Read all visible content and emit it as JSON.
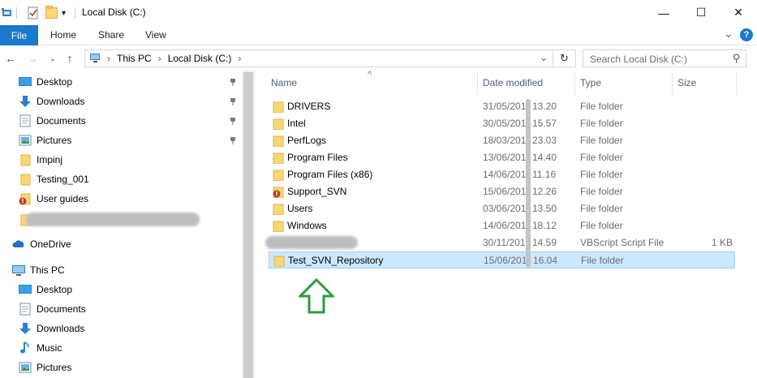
{
  "window": {
    "title": "Local Disk (C:)",
    "minimize_glyph": "—",
    "maximize_glyph": "☐",
    "close_glyph": "✕"
  },
  "ribbon": {
    "tabs": [
      "File",
      "Home",
      "Share",
      "View"
    ],
    "expand_glyph": "⌄",
    "help_glyph": "?"
  },
  "nav": {
    "back_glyph": "←",
    "forward_glyph": "→",
    "recent_glyph": "⌄",
    "up_glyph": "↑",
    "address_segments": [
      "This PC",
      "Local Disk (C:)"
    ],
    "separator": "›",
    "dropdown_glyph": "⌄",
    "refresh_glyph": "↻",
    "search_placeholder": "Search Local Disk (C:)",
    "search_glyph": "⚲"
  },
  "sidebar": {
    "quick_access": [
      {
        "label": "Desktop",
        "icon": "desktop-icon",
        "pinned": true
      },
      {
        "label": "Downloads",
        "icon": "downloads-icon",
        "pinned": true
      },
      {
        "label": "Documents",
        "icon": "documents-icon",
        "pinned": true
      },
      {
        "label": "Pictures",
        "icon": "pictures-icon",
        "pinned": true
      },
      {
        "label": "Impinj",
        "icon": "folder-icon",
        "pinned": false
      },
      {
        "label": "Testing_001",
        "icon": "folder-icon",
        "pinned": false
      },
      {
        "label": "User guides",
        "icon": "svn-conflict-folder-icon",
        "pinned": false
      }
    ],
    "onedrive_label": "OneDrive",
    "thispc_label": "This PC",
    "thispc_items": [
      {
        "label": "Desktop",
        "icon": "desktop-icon"
      },
      {
        "label": "Documents",
        "icon": "documents-icon"
      },
      {
        "label": "Downloads",
        "icon": "downloads-icon"
      },
      {
        "label": "Music",
        "icon": "music-icon"
      },
      {
        "label": "Pictures",
        "icon": "pictures-icon"
      }
    ],
    "pin_glyph": "📌"
  },
  "columns": {
    "name": "Name",
    "date": "Date modified",
    "type": "Type",
    "size": "Size",
    "sort_glyph": "^"
  },
  "files": [
    {
      "name": "DRIVERS",
      "date": "31/05/201",
      "time": "13.20",
      "type": "File folder",
      "size": "",
      "icon": "folder-icon"
    },
    {
      "name": "Intel",
      "date": "30/05/201",
      "time": "15.57",
      "type": "File folder",
      "size": "",
      "icon": "folder-icon"
    },
    {
      "name": "PerfLogs",
      "date": "18/03/201",
      "time": "23.03",
      "type": "File folder",
      "size": "",
      "icon": "folder-icon"
    },
    {
      "name": "Program Files",
      "date": "13/06/201",
      "time": "14.40",
      "type": "File folder",
      "size": "",
      "icon": "folder-icon"
    },
    {
      "name": "Program Files (x86)",
      "date": "14/06/201",
      "time": "11.16",
      "type": "File folder",
      "size": "",
      "icon": "folder-icon"
    },
    {
      "name": "Support_SVN",
      "date": "15/06/201",
      "time": "12.26",
      "type": "File folder",
      "size": "",
      "icon": "svn-conflict-folder-icon"
    },
    {
      "name": "Users",
      "date": "03/06/201",
      "time": "13.50",
      "type": "File folder",
      "size": "",
      "icon": "folder-icon"
    },
    {
      "name": "Windows",
      "date": "14/06/201",
      "time": "18.12",
      "type": "File folder",
      "size": "",
      "icon": "folder-icon"
    },
    {
      "name": "",
      "date": "30/11/201",
      "time": "14.59",
      "type": "VBScript Script File",
      "size": "1 KB",
      "icon": "redacted"
    },
    {
      "name": "Test_SVN_Repository",
      "date": "15/06/201",
      "time": "16.04",
      "type": "File folder",
      "size": "",
      "icon": "folder-icon",
      "selected": true
    }
  ],
  "colors": {
    "file_tab": "#1979ca",
    "selection_bg": "#cce8ff",
    "selection_border": "#99d1ff",
    "arrow_green": "#2e9b3c"
  }
}
